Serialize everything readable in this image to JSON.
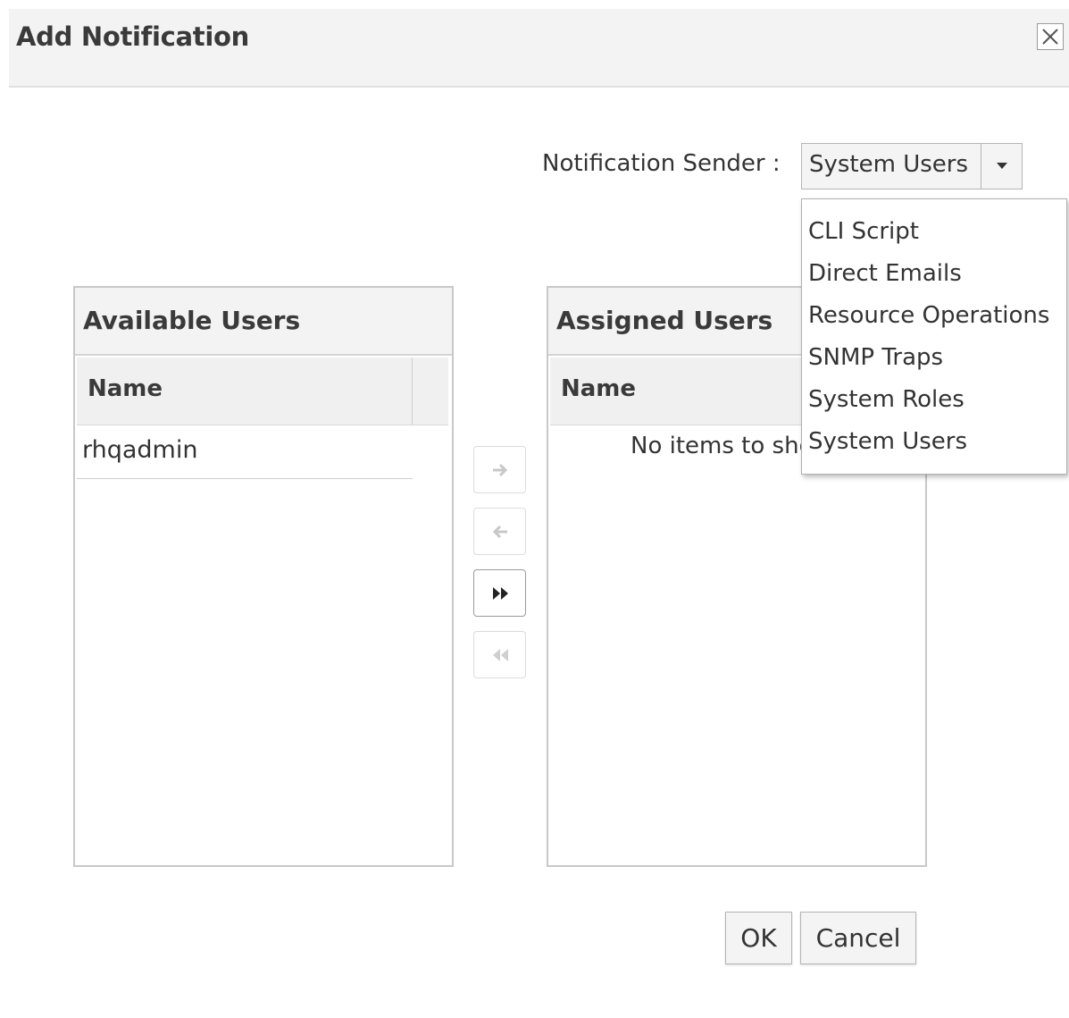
{
  "dialog": {
    "title": "Add Notification",
    "close_icon": "close-icon"
  },
  "sender": {
    "label": "Notification Sender :",
    "selected": "System Users",
    "options": [
      "CLI Script",
      "Direct Emails",
      "Resource Operations",
      "SNMP Traps",
      "System Roles",
      "System Users"
    ]
  },
  "available": {
    "title": "Available Users",
    "column_header": "Name",
    "rows": [
      "rhqadmin"
    ]
  },
  "assigned": {
    "title": "Assigned Users",
    "column_header": "Name",
    "empty_message": "No items to show."
  },
  "transfer": {
    "icons": [
      "arrow-right-icon",
      "arrow-left-icon",
      "move-all-right-icon",
      "move-all-left-icon"
    ]
  },
  "buttons": {
    "ok": "OK",
    "cancel": "Cancel"
  }
}
